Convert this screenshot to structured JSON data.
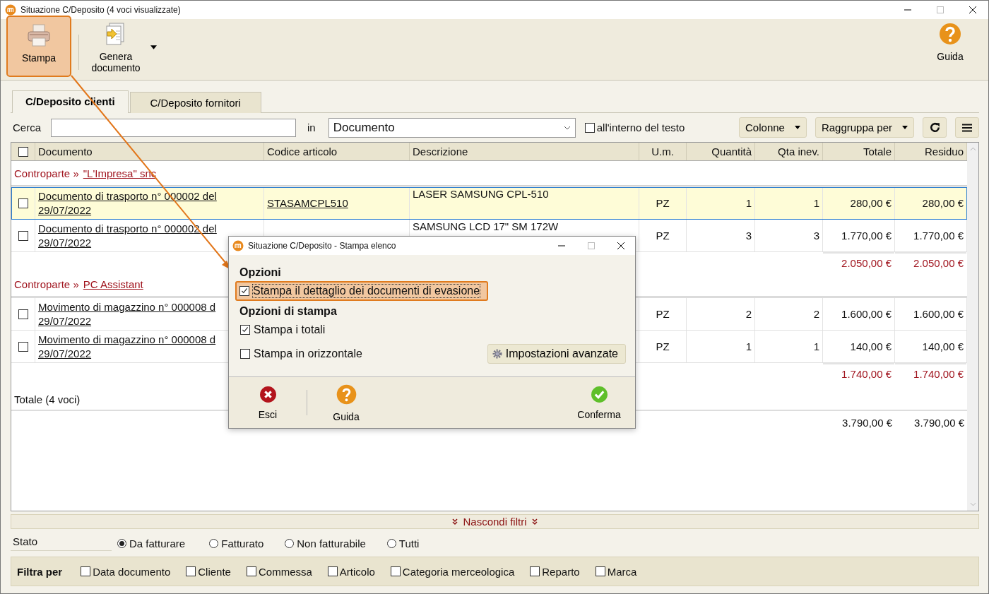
{
  "window": {
    "title": "Situazione C/Deposito (4 voci visualizzate)"
  },
  "toolbar": {
    "buttons": [
      {
        "label": "Stampa",
        "kind": "print",
        "highlighted": true,
        "dropdown": false
      },
      {
        "label": "Genera documento",
        "kind": "generate",
        "highlighted": false,
        "dropdown": true
      },
      {
        "label": "Guida",
        "kind": "help",
        "highlighted": false,
        "dropdown": false
      }
    ]
  },
  "tabs": [
    {
      "label": "C/Deposito clienti",
      "selected": true
    },
    {
      "label": "C/Deposito fornitori",
      "selected": false
    }
  ],
  "search": {
    "label": "Cerca",
    "in_label": "in",
    "field": "Documento",
    "inside_text": {
      "label": "all'interno del testo",
      "checked": false
    },
    "buttons": [
      {
        "label": "Colonne",
        "kind": "dropdown"
      },
      {
        "label": "Raggruppa per",
        "kind": "dropdown"
      },
      {
        "kind": "refresh"
      },
      {
        "kind": "menu"
      }
    ]
  },
  "table": {
    "all_checked": false,
    "columns": [
      "Documento",
      "Codice articolo",
      "Descrizione",
      "U.m.",
      "Quantità",
      "Qta inev.",
      "Totale",
      "Residuo"
    ],
    "groups": [
      {
        "label": "Controparte »",
        "name": "\"L'Impresa\" snc",
        "rows": [
          {
            "checked": false,
            "selected": true,
            "document": [
              "Documento di trasporto n° 000002 del",
              "29/07/2022"
            ],
            "code": "STASAMCPL510",
            "description": "LASER SAMSUNG CPL-510",
            "unit": "PZ",
            "quantity": "1",
            "open_quantity": "1",
            "total": "280,00 €",
            "residual": "280,00 €"
          },
          {
            "checked": false,
            "selected": false,
            "document": [
              "Documento di trasporto n° 000002 del",
              "29/07/2022"
            ],
            "description": "SAMSUNG LCD 17\" SM 172W",
            "unit": "PZ",
            "quantity": "3",
            "open_quantity": "3",
            "total": "1.770,00 €",
            "residual": "1.770,00 €"
          }
        ],
        "subtotal": {
          "total": "2.050,00 €",
          "residual": "2.050,00 €"
        }
      },
      {
        "label": "Controparte »",
        "name": "PC Assistant",
        "rows": [
          {
            "checked": false,
            "selected": false,
            "document": [
              "Movimento di magazzino n° 000008 d",
              "29/07/2022"
            ],
            "unit": "PZ",
            "quantity": "2",
            "open_quantity": "2",
            "total": "1.600,00 €",
            "residual": "1.600,00 €"
          },
          {
            "checked": false,
            "selected": false,
            "document": [
              "Movimento di magazzino n° 000008 d",
              "29/07/2022"
            ],
            "unit": "PZ",
            "quantity": "1",
            "open_quantity": "1",
            "total": "140,00 €",
            "residual": "140,00 €"
          }
        ],
        "subtotal": {
          "total": "1.740,00 €",
          "residual": "1.740,00 €"
        }
      }
    ],
    "grand_total": {
      "label": "Totale (4 voci)",
      "total": "3.790,00 €",
      "residual": "3.790,00 €"
    }
  },
  "filters_toggle": "Nascondi filtri",
  "status": {
    "label": "Stato",
    "options": [
      {
        "label": "Da fatturare",
        "selected": true
      },
      {
        "label": "Fatturato",
        "selected": false
      },
      {
        "label": "Non fatturabile",
        "selected": false
      },
      {
        "label": "Tutti",
        "selected": false
      }
    ]
  },
  "filter_by": {
    "label": "Filtra per",
    "options": [
      {
        "label": "Data documento",
        "checked": false
      },
      {
        "label": "Cliente",
        "checked": false
      },
      {
        "label": "Commessa",
        "checked": false
      },
      {
        "label": "Articolo",
        "checked": false
      },
      {
        "label": "Categoria merceologica",
        "checked": false
      },
      {
        "label": "Reparto",
        "checked": false
      },
      {
        "label": "Marca",
        "checked": false
      }
    ]
  },
  "dialog": {
    "title": "Situazione C/Deposito - Stampa elenco",
    "sections": [
      {
        "heading": "Opzioni",
        "options": [
          {
            "label": "Stampa il dettaglio dei documenti di evasione",
            "checked": true,
            "highlighted": true
          }
        ]
      },
      {
        "heading": "Opzioni di stampa",
        "options": [
          {
            "label": "Stampa i totali",
            "checked": true,
            "highlighted": false
          },
          {
            "label": "Stampa in orizzontale",
            "checked": false,
            "highlighted": false
          }
        ]
      }
    ],
    "advanced_button": "Impostazioni avanzate",
    "buttons": [
      {
        "label": "Esci",
        "kind": "cancel"
      },
      {
        "label": "Guida",
        "kind": "help"
      },
      {
        "label": "Conferma",
        "kind": "confirm"
      }
    ]
  }
}
